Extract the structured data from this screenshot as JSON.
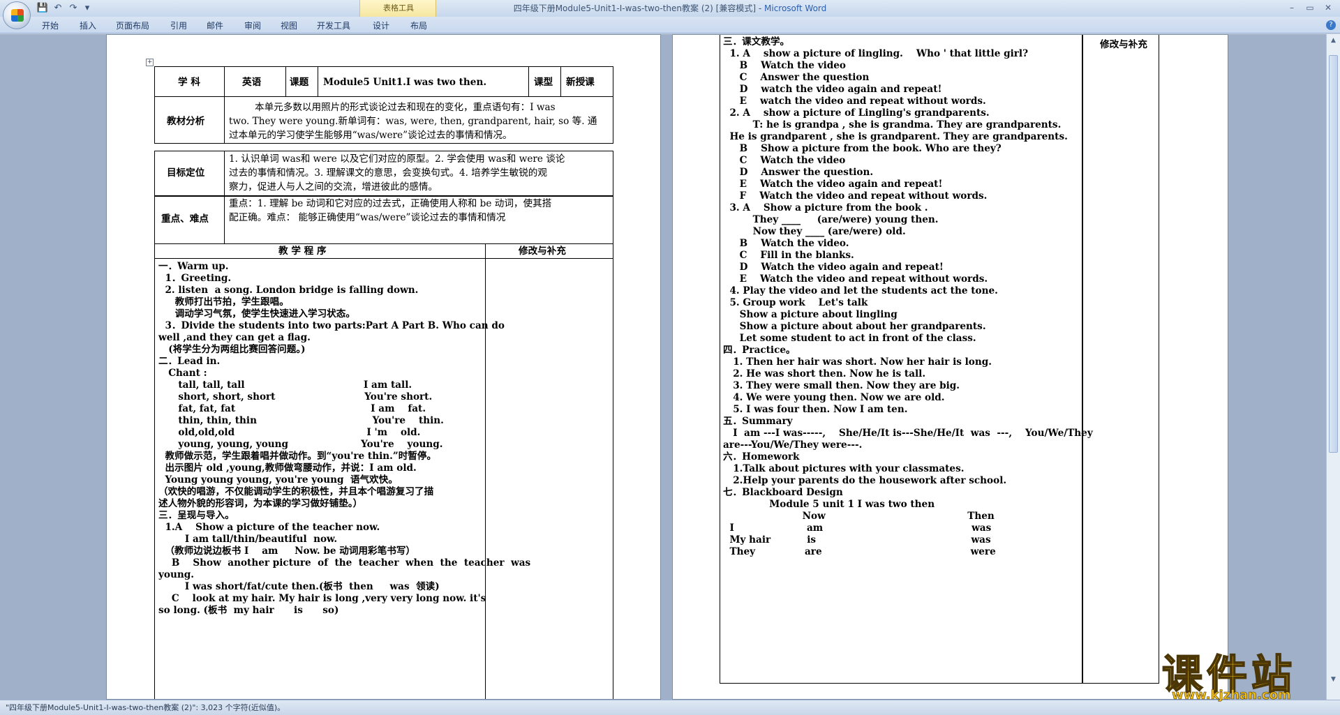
{
  "titlebar": {
    "title": "四年级下册Module5-Unit1-I-was-two-then教案 (2) [兼容模式] -",
    "app": "Microsoft Word",
    "contextual_tab_group": "表格工具",
    "qat_save": "💾",
    "qat_undo": "↶",
    "qat_redo": "↷",
    "qat_more": "▾",
    "win_min": "–",
    "win_max": "▭",
    "win_close": "✕"
  },
  "ribbon": {
    "tabs": [
      "开始",
      "插入",
      "页面布局",
      "引用",
      "邮件",
      "审阅",
      "视图",
      "开发工具",
      "设计",
      "布局"
    ],
    "help": "?"
  },
  "page1": {
    "header_row": {
      "subject_label": "学  科",
      "subject_value": "英语",
      "topic_label": "课题",
      "topic_value": "Module5 Unit1.I was two then.",
      "type_label": "课型",
      "type_value": "新授课"
    },
    "analysis": {
      "label": "教材分析",
      "lines": [
        "本单元多数以用照片的形式谈论过去和现在的变化，重点语句有：I  was",
        "two. They were young.新单词有：was, were, then, grandparent, hair, so 等.   通",
        "过本单元的学习使学生能够用“was/were”谈论过去的事情和情况。"
      ]
    },
    "goals": {
      "label": "目标定位",
      "lines": [
        "1. 认识单词 was和 were 以及它们对应的原型。2. 学会使用  was和 were 谈论",
        "过去的事情和情况。3. 理解课文的意思，会变换句式。4. 培养学生敏锐的观",
        "察力，促进人与人之间的交流，增进彼此的感情。"
      ]
    },
    "key_points": {
      "label": "重点、难点",
      "lines": [
        "重点：1. 理解 be 动词和它对应的过去式，正确使用人称和 be 动词，使其搭",
        "配正确。难点：  能够正确使用“was/were”谈论过去的事情和情况"
      ]
    },
    "procedure_header": "教  学  程  序",
    "notes_header": "修改与补充",
    "procedure_lines": [
      "一．Warm up.",
      "  1．Greeting.",
      "  2. listen  a song. London bridge is falling down.",
      "     教师打出节拍，学生跟唱。",
      "     调动学习气氛，使学生快速进入学习状态。",
      "  3．Divide the students into two parts:Part A Part B. Who can do",
      "well ,and they can get a flag.",
      "   (将学生分为两组比赛回答问题。)",
      "二．Lead in.",
      "   Chant :",
      "      tall, tall, tall                                    I am tall.",
      "      short, short, short                           You're short.",
      "      fat, fat, fat                                         I am    fat.",
      "      thin, thin, thin                                   You're    thin.",
      "      old,old,old                                        I 'm    old.",
      "      young, young, young                      You're    young.",
      "  教师做示范，学生跟着唱并做动作。到“you're thin.”时暂停。",
      "  出示图片 old ,young,教师做弯腰动作，并说：I am old.",
      "  Young young young, you're young  语气欢快。",
      "（欢快的唱游，不仅能调动学生的积极性，并且本个唱游复习了描",
      "述人物外貌的形容词，为本课的学习做好铺垫。）",
      "三．呈现与导入。",
      "  1.A    Show a picture of the teacher now.",
      "        I am tall/thin/beautiful  now.",
      "  （教师边说边板书 I    am     Now. be 动词用彩笔书写）",
      "    B    Show  another picture  of  the  teacher  when  the  teacher  was",
      "young.",
      "        I was short/fat/cute then.(板书  then     was  领读)",
      "    C    look at my hair. My hair is long ,very very long now. it's",
      "so long. (板书  my hair      is      so)"
    ]
  },
  "page2": {
    "notes_header": "修改与补充",
    "lines": [
      "三．课文教学。",
      "  1. A    show a picture of lingling.    Who ' that little girl?",
      "     B    Watch the video",
      "     C    Answer the question",
      "     D    watch the video again and repeat!",
      "     E    watch the video and repeat without words.",
      "  2. A    show a picture of Lingling's grandparents.",
      "         T: he is grandpa , she is grandma. They are grandparents.",
      "  He is grandparent , she is grandparent. They are grandparents.",
      "     B    Show a picture from the book. Who are they?",
      "     C    Watch the video",
      "     D    Answer the question.",
      "     E    Watch the video again and repeat!",
      "     F    Watch the video and repeat without words.",
      "  3. A    Show a picture from the book .",
      "         They ____     (are/were) young then.",
      "         Now they ____ (are/were) old.",
      "     B    Watch the video.",
      "     C    Fill in the blanks.",
      "     D    Watch the video again and repeat!",
      "     E    Watch the video and repeat without words.",
      "  4. Play the video and let the students act the tone.",
      "  5. Group work    Let's talk",
      "     Show a picture about lingling",
      "     Show a picture about about her grandparents.",
      "     Let some student to act in front of the class.",
      "四．Practice。",
      "   1. Then her hair was short. Now her hair is long.",
      "   2. He was short then. Now he is tall.",
      "   3. They were small then. Now they are big.",
      "   4. We were young then. Now we are old.",
      "   5. I was four then. Now I am ten.",
      "五．Summary",
      "   I  am ---I was-----,    She/He/It is---She/He/It  was  ---,    You/We/They",
      "are---You/We/They were---.",
      "六．Homework",
      "   1.Talk about pictures with your classmates.",
      "   2.Help your parents do the housework after school.",
      "七．Blackboard Design",
      "              Module 5 unit 1 I was two then",
      "                        Now                                           Then",
      "  I                      am                                             was",
      "  My hair           is                                               was",
      "  They               are                                             were"
    ]
  },
  "statusbar": {
    "text": "\"四年级下册Module5-Unit1-I-was-two-then教案 (2)\": 3,023 个字符(近似值)。"
  },
  "watermark": {
    "logo_text": "课件站",
    "url": "www.kjzhan.com"
  },
  "colors": {
    "ribbon_bg": "#c8d8ee",
    "workspace_bg": "#9fb0c8",
    "watermark_yellow": "#f3c019"
  },
  "icons": [
    "office-logo-icon",
    "save-icon",
    "undo-icon",
    "redo-icon",
    "help-icon",
    "table-move-handle-icon"
  ]
}
